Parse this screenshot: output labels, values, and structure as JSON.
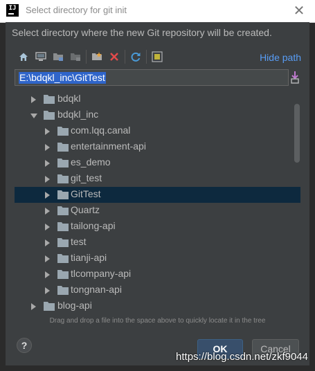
{
  "window": {
    "app_icon_text": "IJ",
    "title": "Select directory for git init"
  },
  "dialog": {
    "description": "Select directory where the new Git repository will be created.",
    "hide_path_label": "Hide path",
    "path_value": "E:\\bdqkl_inc\\GitTest",
    "toolbar_icons": [
      "home-icon",
      "desktop-icon",
      "project-folder-icon",
      "module-folder-icon",
      "new-folder-icon",
      "delete-icon",
      "refresh-icon",
      "show-hidden-icon"
    ]
  },
  "tree": {
    "rows": [
      {
        "label": "bdqkl",
        "expanded": false
      },
      {
        "label": "bdqkl_inc",
        "expanded": true
      },
      {
        "label": "com.lqq.canal",
        "expanded": false
      },
      {
        "label": "entertainment-api",
        "expanded": false
      },
      {
        "label": "es_demo",
        "expanded": false
      },
      {
        "label": "git_test",
        "expanded": false
      },
      {
        "label": "GitTest",
        "expanded": false,
        "selected": true
      },
      {
        "label": "Quartz",
        "expanded": false
      },
      {
        "label": "tailong-api",
        "expanded": false
      },
      {
        "label": "test",
        "expanded": false
      },
      {
        "label": "tianji-api",
        "expanded": false
      },
      {
        "label": "tlcompany-api",
        "expanded": false
      },
      {
        "label": "tongnan-api",
        "expanded": false
      },
      {
        "label": "blog-api",
        "expanded": false
      }
    ]
  },
  "footer": {
    "hint": "Drag and drop a file into the space above to quickly locate it in the tree",
    "help_label": "?",
    "ok_label": "OK",
    "cancel_label": "Cancel"
  },
  "watermark": "https://blog.csdn.net/zkf9044",
  "colors": {
    "dialog_bg": "#3c3f41",
    "selection_bg": "#0d293e",
    "path_selection": "#2f65ca",
    "link": "#589df6"
  }
}
